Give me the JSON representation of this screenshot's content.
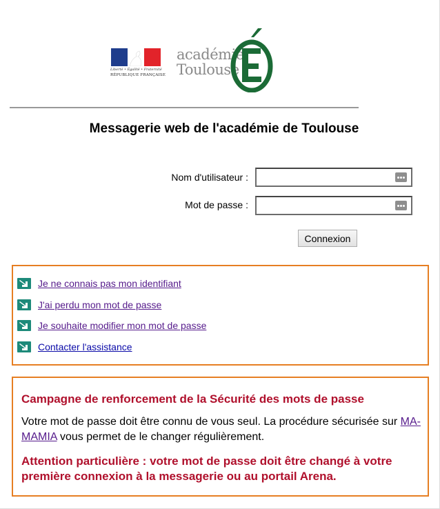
{
  "header": {
    "flag_motto": "Liberté • Égalité • Fraternité",
    "flag_republic": "RÉPUBLIQUE FRANÇAISE",
    "academy_line1": "académie",
    "academy_line2": "Toulouse",
    "academy_letter": "É"
  },
  "colors": {
    "flag_blue": "#1f3d8c",
    "flag_white": "#ffffff",
    "flag_red": "#e2232a",
    "academy_green": "#1b6b36",
    "box_border": "#e67e22",
    "alert_red": "#b0102c",
    "arrow_teal": "#1d8a7a"
  },
  "page_title": "Messagerie web de l'académie de Toulouse",
  "form": {
    "username_label": "Nom d'utilisateur :",
    "username_value": "",
    "password_label": "Mot de passe :",
    "password_value": "",
    "field_icon": "password-manager-icon",
    "submit_label": "Connexion"
  },
  "help_links": {
    "icon": "arrow-down-right-icon",
    "items": [
      {
        "label": "Je ne connais pas mon identifiant",
        "visited": true
      },
      {
        "label": "J'ai perdu mon mot de passe",
        "visited": true
      },
      {
        "label": "Je souhaite modifier mon mot de passe",
        "visited": true
      },
      {
        "label": "Contacter l'assistance",
        "visited": false
      }
    ]
  },
  "security_notice": {
    "title": "Campagne de renforcement de la Sécurité des mots de passe",
    "body_before": "Votre mot de passe doit être connu de vous seul. La procédure sécurisée sur ",
    "body_link": "MA-MAMIA",
    "body_after": " vous permet de le changer régulièrement.",
    "warning": "Attention particulière : votre mot de passe doit être changé à votre première connexion à la messagerie ou au portail Arena."
  }
}
